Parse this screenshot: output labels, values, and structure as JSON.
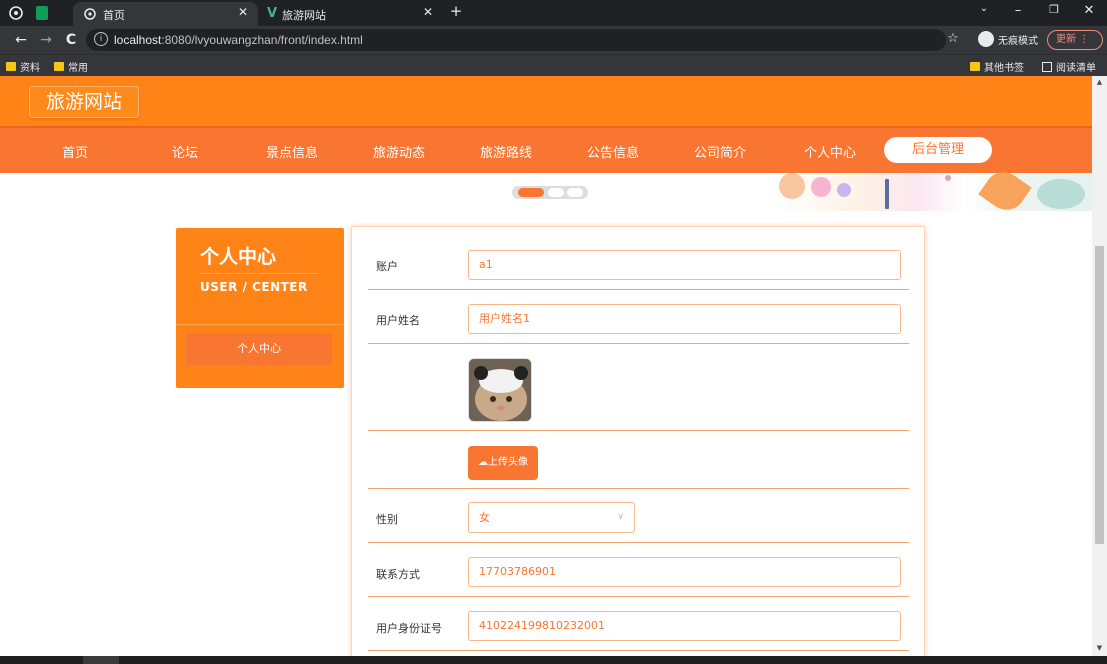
{
  "browser": {
    "tabs": [
      {
        "title": "首页",
        "active": true
      },
      {
        "title": "旅游网站",
        "active": false
      }
    ],
    "url_host": "localhost",
    "url_rest": ":8080/lvyouwangzhan/front/index.html",
    "incognito_label": "无痕模式",
    "update_label": "更新",
    "bookmarks": [
      {
        "label": "资料"
      },
      {
        "label": "常用"
      }
    ],
    "other_bookmarks": "其他书签",
    "reading_list": "阅读清单"
  },
  "site": {
    "logo": "旅游网站",
    "nav": [
      "首页",
      "论坛",
      "景点信息",
      "旅游动态",
      "旅游路线",
      "公告信息",
      "公司简介",
      "个人中心"
    ],
    "admin_label": "后台管理"
  },
  "sidebar": {
    "title": "个人中心",
    "subtitle": "USER / CENTER",
    "items": [
      {
        "label": "个人中心"
      }
    ]
  },
  "form": {
    "account_label": "账户",
    "account_value": "a1",
    "name_label": "用户姓名",
    "name_value": "用户姓名1",
    "upload_label": "上传头像",
    "gender_label": "性别",
    "gender_value": "女",
    "phone_label": "联系方式",
    "phone_value": "17703786901",
    "id_label": "用户身份证号",
    "id_value": "410224199810232001"
  },
  "colors": {
    "primary": "#ff8316",
    "nav": "#f97632",
    "chrome_dark": "#202124",
    "chrome": "#35363a"
  }
}
